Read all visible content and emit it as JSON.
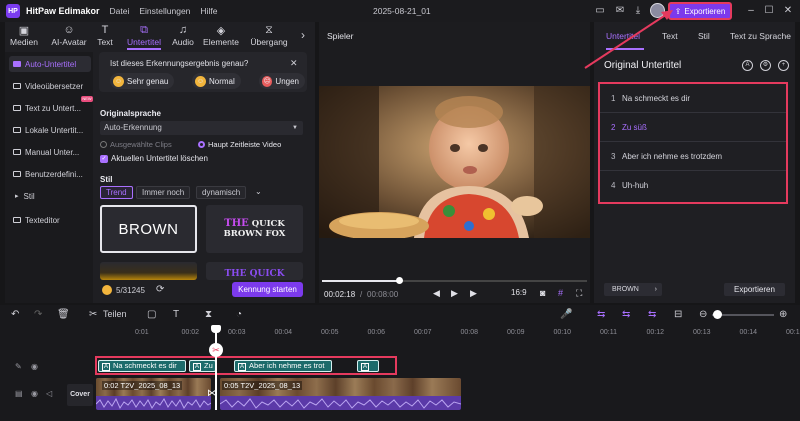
{
  "app": {
    "name": "HitPaw Edimakor",
    "logo_text": "HP",
    "menu": [
      "Datei",
      "Einstellungen",
      "Hilfe"
    ],
    "doc_title": "2025-08-21_01",
    "export_button": "Exportieren",
    "accent_color": "#7c3aed",
    "highlight_color": "#e53a5e"
  },
  "top_tabs": [
    {
      "label": "Medien",
      "icon": "media-icon"
    },
    {
      "label": "AI-Avatar",
      "icon": "avatar-icon"
    },
    {
      "label": "Text",
      "icon": "text-icon"
    },
    {
      "label": "Untertitel",
      "icon": "subtitle-icon",
      "active": true
    },
    {
      "label": "Audio",
      "icon": "audio-icon"
    },
    {
      "label": "Elemente",
      "icon": "elements-icon"
    },
    {
      "label": "Übergang",
      "icon": "transition-icon"
    }
  ],
  "sidebar": [
    {
      "label": "Auto-Untertitel",
      "active": true
    },
    {
      "label": "Videoübersetzer",
      "badge": "NEW"
    },
    {
      "label": "Text zu Untert..."
    },
    {
      "label": "Lokale Untertit..."
    },
    {
      "label": "Manual Unter..."
    },
    {
      "label": "Benutzerdefini..."
    },
    {
      "label": "Stil"
    },
    {
      "label": "Texteditor"
    }
  ],
  "feedback": {
    "question": "Ist dieses Erkennungsergebnis genau?",
    "options": [
      "Sehr genau",
      "Normal",
      "Ungen"
    ]
  },
  "original_language": {
    "title": "Originalsprache",
    "value": "Auto-Erkennung",
    "radio_options": [
      {
        "label": "Ausgewählte Clips",
        "selected": false
      },
      {
        "label": "Haupt Zeitleiste Video",
        "selected": true
      }
    ],
    "checkbox_label": "Aktuellen Untertitel löschen",
    "checkbox_checked": true
  },
  "style_section": {
    "title": "Stil",
    "chips": [
      "Trend",
      "Immer noch",
      "dynamisch"
    ],
    "active_chip": "Trend",
    "card_brown": "BROWN",
    "card_quick_line1_purple": "THE",
    "card_quick_line1": "QUICK",
    "card_quick_line2": "BROWN FOX"
  },
  "credits": {
    "value": "5/31245",
    "start_button": "Kennung starten"
  },
  "player": {
    "title": "Spieler",
    "current_time": "00:02:18",
    "total_time": "00:08:00",
    "progress": 0.29,
    "aspect": "16:9"
  },
  "right_tabs": [
    "Untertitel",
    "Text",
    "Stil",
    "Text zu Sprache"
  ],
  "right_panel": {
    "title": "Original Untertitel",
    "subtitles": [
      {
        "num": "1",
        "text": "Na  schmeckt es dir"
      },
      {
        "num": "2",
        "text": "Zu süß",
        "active": true
      },
      {
        "num": "3",
        "text": "Aber ich nehme es trotzdem"
      },
      {
        "num": "4",
        "text": "Uh-huh"
      }
    ],
    "style_chip": "BROWN",
    "export_button": "Exportieren"
  },
  "timeline": {
    "split_label": "Teilen",
    "ruler_labels": [
      "0:01",
      "00:02",
      "00:03",
      "00:04",
      "00:05",
      "00:06",
      "00:07",
      "00:08",
      "00:09",
      "00:10",
      "00:11",
      "00:12",
      "00:13",
      "00:14",
      "00:15"
    ],
    "subtitle_clips": [
      "Na  schmeckt es dir",
      "Zu",
      "Aber ich nehme es trot",
      ""
    ],
    "cover_label": "Cover",
    "video_clip_1": "0:02  T2V_2025_08_13",
    "video_clip_2": "0:05  T2V_2025_08_13"
  }
}
